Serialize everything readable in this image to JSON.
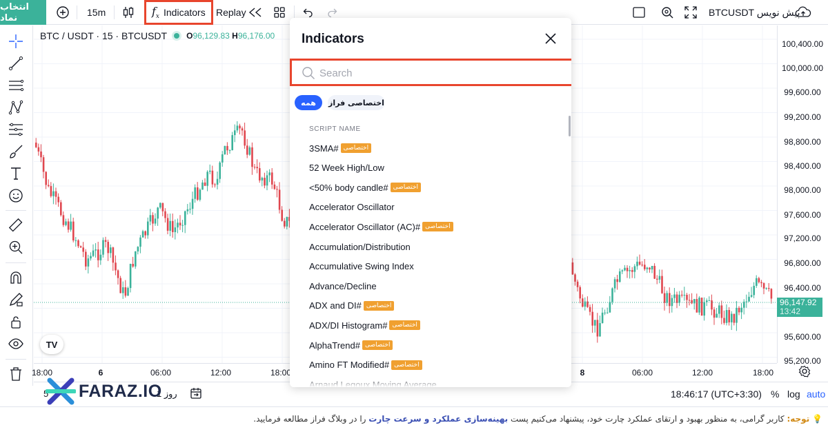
{
  "toolbar": {
    "symbol_button": "انتخاب نماد",
    "interval": "15m",
    "indicators_label": "Indicators",
    "replay_label": "Replay",
    "symbol_name": "BTCUSDT پیش نویس"
  },
  "chart": {
    "title": "BTC / USDT · 15 · BTCUSDT",
    "ohlc_prefix": "O",
    "ohlc_open": "96,129.83",
    "ohlc_high_prefix": "H",
    "ohlc_high": "96,176.00",
    "logo": "TV",
    "last_price": "96,147.92",
    "last_time": "13:42",
    "price_labels": [
      "100,400.00",
      "100,000.00",
      "99,600.00",
      "99,200.00",
      "98,800.00",
      "98,400.00",
      "98,000.00",
      "97,600.00",
      "97,200.00",
      "96,800.00",
      "96,400.00",
      "95,600.00",
      "95,200.00"
    ],
    "time_labels": [
      "18:00",
      "6",
      "06:00",
      "12:00",
      "18:00",
      "8",
      "06:00",
      "12:00",
      "18:00"
    ]
  },
  "bottom": {
    "time": "18:46:17 (UTC+3:30)",
    "percent": "%",
    "log": "log",
    "auto": "auto",
    "range_1d": "1 روز",
    "range_5": "5",
    "brand": "FARAZ.IO"
  },
  "notice": {
    "title": "توجه:",
    "text_before": " کاربر گرامی، به منظور بهبود و ارتقای عملکرد چارت خود، پیشنهاد می‌کنیم پست ",
    "highlight": "بهینه‌سازی عملکرد و سرعت چارت",
    "text_after": " را در وبلاگ فراز مطالعه فرمایید."
  },
  "dialog": {
    "title": "Indicators",
    "search_placeholder": "Search",
    "filter_all": "همه",
    "filter_exclusive": "اختصاصی فراز",
    "column_header": "SCRIPT NAME",
    "badge_text": "اختصاصی",
    "items": [
      {
        "name": "3SMA#",
        "exclusive": true
      },
      {
        "name": "52 Week High/Low",
        "exclusive": false
      },
      {
        "name": "<50% body candle#",
        "exclusive": true
      },
      {
        "name": "Accelerator Oscillator",
        "exclusive": false
      },
      {
        "name": "Accelerator Oscillator (AC)#",
        "exclusive": true
      },
      {
        "name": "Accumulation/Distribution",
        "exclusive": false
      },
      {
        "name": "Accumulative Swing Index",
        "exclusive": false
      },
      {
        "name": "Advance/Decline",
        "exclusive": false
      },
      {
        "name": "ADX and DI#",
        "exclusive": true
      },
      {
        "name": "ADX/DI Histogram#",
        "exclusive": true
      },
      {
        "name": "AlphaTrend#",
        "exclusive": true
      },
      {
        "name": "Amino FT Modified#",
        "exclusive": true
      },
      {
        "name": "Arnaud Legoux Moving Average",
        "exclusive": false
      }
    ]
  },
  "colors": {
    "up": "#3bb29a",
    "down": "#e0474f",
    "accent": "#2962ff",
    "highlight_border": "#e8452d",
    "badge": "#f0a030"
  }
}
